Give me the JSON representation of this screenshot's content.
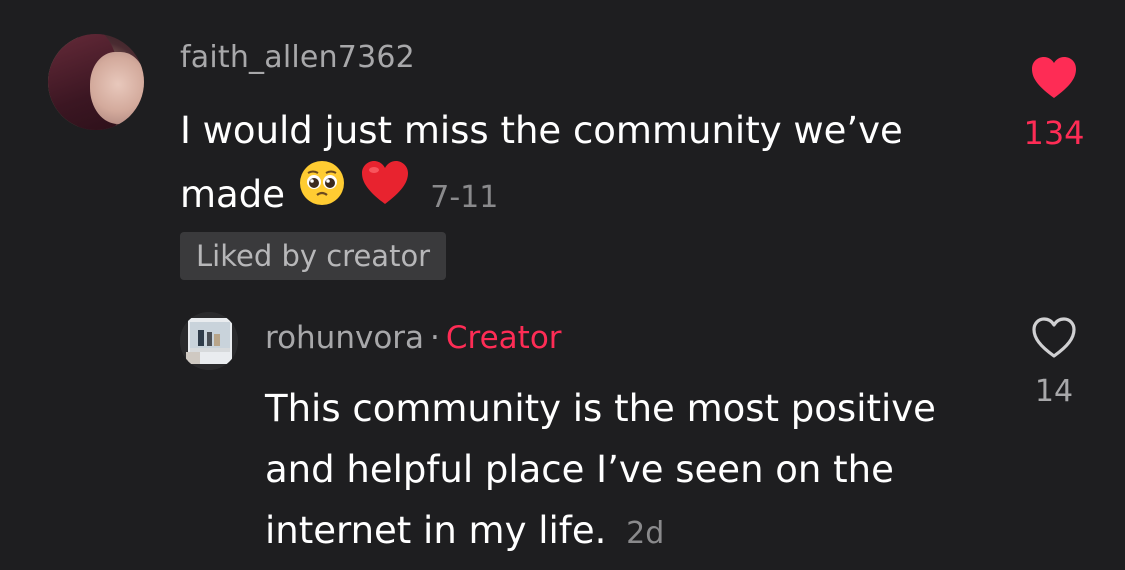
{
  "comment": {
    "username": "faith_allen7362",
    "text": "I would just miss the community we’ve made",
    "emojis": [
      "pleading-face-icon",
      "red-heart-icon"
    ],
    "timestamp": "7-11",
    "liked_badge": "Liked by creator",
    "like_count": "134",
    "liked": true,
    "like_color": "#fe2c55"
  },
  "reply": {
    "username": "rohunvora",
    "separator": "·",
    "creator_label": "Creator",
    "text": "This community is the most positive and helpful place I’ve seen on the internet in my life.",
    "timestamp": "2d",
    "like_count": "14",
    "liked": false
  }
}
